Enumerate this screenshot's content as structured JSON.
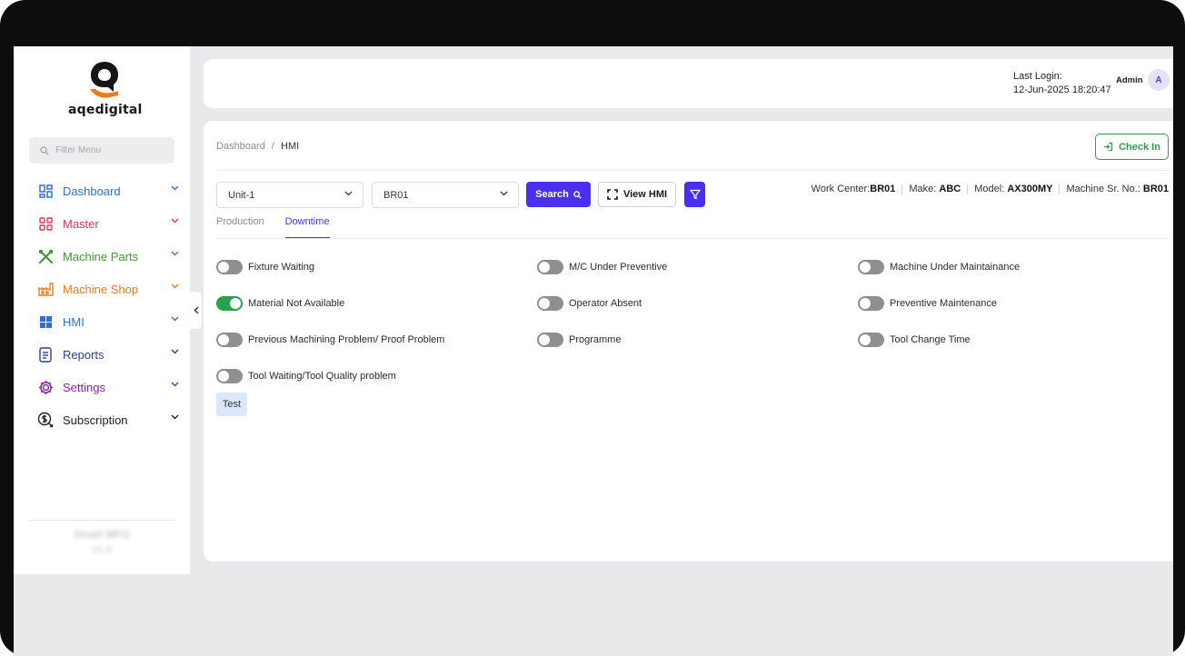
{
  "brand": {
    "name": "aqedigital"
  },
  "sidebar": {
    "filter_placeholder": "Filter Menu",
    "items": [
      {
        "label": "Dashboard",
        "icon": "dashboard-icon",
        "color": "#2f6fdc"
      },
      {
        "label": "Master",
        "icon": "grid-icon",
        "color": "#e0364f"
      },
      {
        "label": "Machine Parts",
        "icon": "tools-icon",
        "color": "#3d9a2e"
      },
      {
        "label": "Machine Shop",
        "icon": "factory-icon",
        "color": "#f07a1a"
      },
      {
        "label": "HMI",
        "icon": "windows-icon",
        "color": "#2f6fdc"
      },
      {
        "label": "Reports",
        "icon": "report-icon",
        "color": "#2c3e9e"
      },
      {
        "label": "Settings",
        "icon": "gear-icon",
        "color": "#8a1faa"
      },
      {
        "label": "Subscription",
        "icon": "subscription-icon",
        "color": "#222222"
      }
    ],
    "footer_title": "Smart MFG",
    "footer_version": "V1.0"
  },
  "header": {
    "last_login_label": "Last Login:",
    "last_login_value": "12-Jun-2025 18:20:47",
    "user_name": "Admin",
    "avatar_letter": "A"
  },
  "breadcrumb": {
    "root": "Dashboard",
    "separator": "/",
    "current": "HMI"
  },
  "actions": {
    "check_in": "Check In"
  },
  "filters": {
    "unit": "Unit-1",
    "machine": "BR01",
    "search_label": "Search",
    "view_hmi_label": "View HMI"
  },
  "machine_info": {
    "work_center_label": "Work Center:",
    "work_center": "BR01",
    "make_label": "Make:",
    "make": "ABC",
    "model_label": "Model:",
    "model": "AX300MY",
    "serial_label": "Machine Sr. No.:",
    "serial": "BR01"
  },
  "tabs": [
    {
      "label": "Production",
      "active": false
    },
    {
      "label": "Downtime",
      "active": true
    }
  ],
  "downtime_reasons": [
    {
      "label": "Fixture Waiting",
      "on": false
    },
    {
      "label": "M/C Under Preventive",
      "on": false
    },
    {
      "label": "Machine Under Maintainance",
      "on": false
    },
    {
      "label": "Material Not Available",
      "on": true
    },
    {
      "label": "Operator Absent",
      "on": false
    },
    {
      "label": "Preventive Maintenance",
      "on": false
    },
    {
      "label": "Previous Machining Problem/ Proof Problem",
      "on": false
    },
    {
      "label": "Programme",
      "on": false
    },
    {
      "label": "Tool Change Time",
      "on": false
    },
    {
      "label": "Tool Waiting/Tool Quality problem",
      "on": false
    }
  ],
  "test_button": "Test",
  "colors": {
    "primary": "#4b2ff0",
    "success": "#29a04a",
    "toggle_off": "#8e8e93"
  }
}
